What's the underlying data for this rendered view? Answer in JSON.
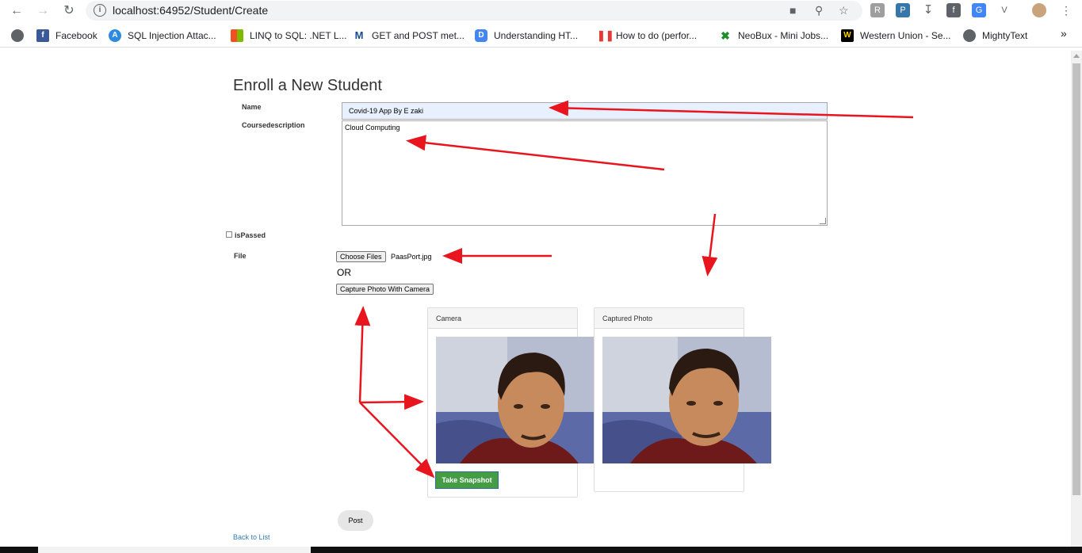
{
  "browser": {
    "url": "localhost:64952/Student/Create",
    "bookmarks": [
      {
        "label": "Facebook",
        "icon": "facebook-icon",
        "color": "#3b5998"
      },
      {
        "label": "SQL Injection Attac...",
        "icon": "asp-icon",
        "color": "#2d8ae0"
      },
      {
        "label": "LINQ to SQL: .NET L...",
        "icon": "microsoft-icon",
        "color": "#f25022"
      },
      {
        "label": "GET and POST met...",
        "icon": "m-icon",
        "color": "#1a4b8c"
      },
      {
        "label": "Understanding HT...",
        "icon": "d-icon",
        "color": "#4285f4"
      },
      {
        "label": "How to do (perfor...",
        "icon": "pause-icon",
        "color": "#e53935"
      },
      {
        "label": "NeoBux - Mini Jobs...",
        "icon": "neobux-icon",
        "color": "#1f8f2b"
      },
      {
        "label": "Western Union - Se...",
        "icon": "wu-icon",
        "color": "#000000"
      },
      {
        "label": "MightyText",
        "icon": "globe-icon",
        "color": "#5f6368"
      }
    ]
  },
  "form": {
    "title": "Enroll a New Student",
    "name_label": "Name",
    "name_value": "Covid-19 App By E zaki",
    "desc_label": "Coursedescription",
    "desc_value": "Cloud Computing",
    "ispassed_label": "isPassed",
    "file_label": "File",
    "choose_files": "Choose Files",
    "file_name": "PaasPort.jpg",
    "or": "OR",
    "capture_button": "Capture Photo With Camera",
    "camera_title": "Camera",
    "captured_title": "Captured Photo",
    "snapshot_button": "Take Snapshot",
    "post_button": "Post",
    "back_link": "Back to List"
  },
  "colors": {
    "arrow": "#e8141e",
    "snapshot": "#449d44",
    "link": "#337ab7"
  }
}
